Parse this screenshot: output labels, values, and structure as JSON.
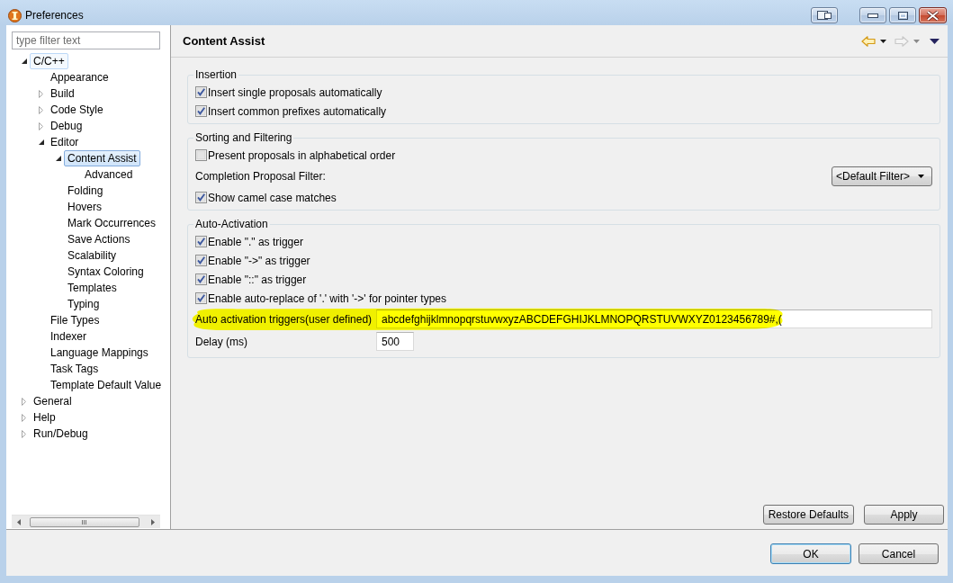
{
  "window": {
    "title": "Preferences"
  },
  "filter": {
    "placeholder": "type filter text"
  },
  "tree": [
    {
      "label": "C/C++",
      "expanded": true,
      "selected": false,
      "hovered": true,
      "children": [
        {
          "label": "Appearance",
          "selected": false,
          "hovered": false
        },
        {
          "label": "Build",
          "expanded": false,
          "selected": false,
          "hovered": false
        },
        {
          "label": "Code Style",
          "expanded": false,
          "selected": false,
          "hovered": false
        },
        {
          "label": "Debug",
          "expanded": false,
          "selected": false,
          "hovered": false
        },
        {
          "label": "Editor",
          "expanded": true,
          "selected": false,
          "hovered": false,
          "children": [
            {
              "label": "Content Assist",
              "expanded": true,
              "selected": true,
              "hovered": false,
              "children": [
                {
                  "label": "Advanced",
                  "selected": false,
                  "hovered": false
                }
              ]
            },
            {
              "label": "Folding",
              "selected": false,
              "hovered": false
            },
            {
              "label": "Hovers",
              "selected": false,
              "hovered": false
            },
            {
              "label": "Mark Occurrences",
              "selected": false,
              "hovered": false
            },
            {
              "label": "Save Actions",
              "selected": false,
              "hovered": false
            },
            {
              "label": "Scalability",
              "selected": false,
              "hovered": false
            },
            {
              "label": "Syntax Coloring",
              "selected": false,
              "hovered": false
            },
            {
              "label": "Templates",
              "selected": false,
              "hovered": false
            },
            {
              "label": "Typing",
              "selected": false,
              "hovered": false
            }
          ]
        },
        {
          "label": "File Types",
          "selected": false,
          "hovered": false
        },
        {
          "label": "Indexer",
          "selected": false,
          "hovered": false
        },
        {
          "label": "Language Mappings",
          "selected": false,
          "hovered": false
        },
        {
          "label": "Task Tags",
          "selected": false,
          "hovered": false
        },
        {
          "label": "Template Default Value",
          "selected": false,
          "hovered": false
        }
      ]
    },
    {
      "label": "General",
      "expanded": false,
      "selected": false,
      "hovered": false
    },
    {
      "label": "Help",
      "expanded": false,
      "selected": false,
      "hovered": false
    },
    {
      "label": "Run/Debug",
      "expanded": false,
      "selected": false,
      "hovered": false
    }
  ],
  "page": {
    "title": "Content Assist",
    "nav": [
      {
        "kind": "back",
        "disabled": false
      },
      {
        "kind": "forward",
        "disabled": true
      }
    ],
    "groups": [
      {
        "title": "Insertion",
        "items": [
          {
            "kind": "checkbox",
            "label": "Insert single proposals automatically",
            "checked": true
          },
          {
            "kind": "checkbox",
            "label": "Insert common prefixes automatically",
            "checked": true
          }
        ]
      },
      {
        "title": "Sorting and Filtering",
        "items": [
          {
            "kind": "checkbox",
            "label": "Present proposals in alphabetical order",
            "checked": false
          },
          {
            "kind": "dropdown",
            "label": "Completion Proposal Filter:",
            "value": "<Default Filter>"
          },
          {
            "kind": "checkbox",
            "label": "Show camel case matches",
            "checked": true
          }
        ]
      },
      {
        "title": "Auto-Activation",
        "items": [
          {
            "kind": "checkbox",
            "label": "Enable \".\" as trigger",
            "checked": true
          },
          {
            "kind": "checkbox",
            "label": "Enable \"->\" as trigger",
            "checked": true
          },
          {
            "kind": "checkbox",
            "label": "Enable \"::\" as trigger",
            "checked": true
          },
          {
            "kind": "checkbox",
            "label": "Enable auto-replace of '.' with '->' for pointer types",
            "checked": true
          },
          {
            "kind": "text",
            "label": "Auto activation triggers(user defined)",
            "value": "abcdefghijklmnopqrstuvwxyzABCDEFGHIJKLMNOPQRSTUVWXYZ0123456789#,(",
            "highlighted": true
          },
          {
            "kind": "number",
            "label": "Delay (ms)",
            "value": "500",
            "highlighted": false
          }
        ]
      }
    ],
    "buttons": [
      "Restore Defaults",
      "Apply"
    ]
  },
  "dialog_buttons": [
    {
      "label": "OK",
      "default": true
    },
    {
      "label": "Cancel",
      "default": false
    }
  ]
}
